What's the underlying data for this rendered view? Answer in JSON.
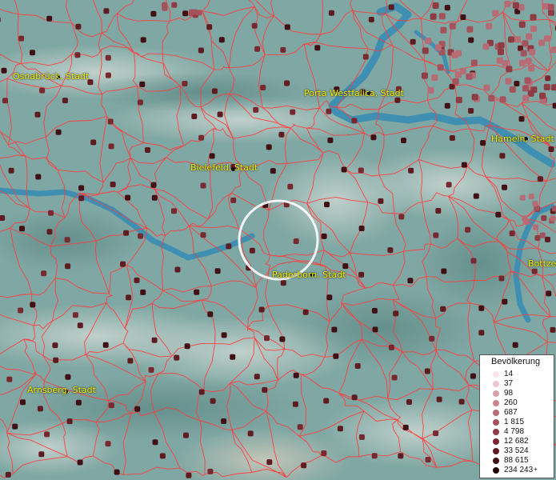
{
  "colors": {
    "terrain": "#7fa7a3",
    "water": "#3f8fb3",
    "borders": "#ff3b3b",
    "label": "#f4f000",
    "highlight_ring": "#ffffff"
  },
  "cities": [
    {
      "name": "Osnabrück, Stadt"
    },
    {
      "name": "Porta Westfalica, Stadt"
    },
    {
      "name": "Hameln, Stadt"
    },
    {
      "name": "Bielefeld, Stadt"
    },
    {
      "name": "Paderborn, Stadt"
    },
    {
      "name": "Bottzen"
    },
    {
      "name": "Arnsberg, Stadt"
    }
  ],
  "legend": {
    "title": "Bevölkerung",
    "items": [
      {
        "label": "14",
        "color": "#fbe4ec"
      },
      {
        "label": "37",
        "color": "#efc2cf"
      },
      {
        "label": "98",
        "color": "#d9a1ad"
      },
      {
        "label": "260",
        "color": "#c88590"
      },
      {
        "label": "687",
        "color": "#b66b75"
      },
      {
        "label": "1 815",
        "color": "#a4525b"
      },
      {
        "label": "4 798",
        "color": "#8f3b44"
      },
      {
        "label": "12 682",
        "color": "#782930"
      },
      {
        "label": "33 524",
        "color": "#5e1b20"
      },
      {
        "label": "88 615",
        "color": "#401014"
      },
      {
        "label": "234 243",
        "color": "#1e0709",
        "suffix": "+"
      }
    ]
  }
}
